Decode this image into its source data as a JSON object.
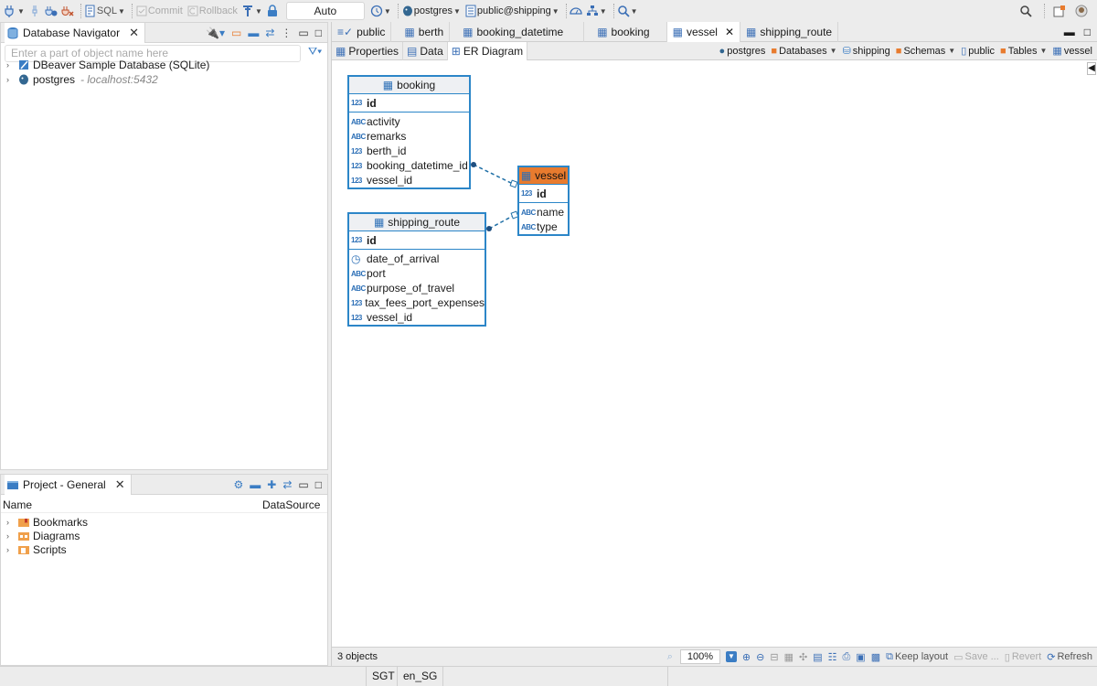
{
  "toolbar": {
    "sql_label": "SQL",
    "commit_label": "Commit",
    "rollback_label": "Rollback",
    "txn_mode": "Auto",
    "datasource": "postgres",
    "schema": "public@shipping"
  },
  "navigator": {
    "title": "Database Navigator",
    "filter_placeholder": "Enter a part of object name here",
    "items": [
      {
        "label": "DBeaver Sample Database (SQLite)",
        "host": ""
      },
      {
        "label": "postgres",
        "host": "- localhost:5432"
      }
    ]
  },
  "project": {
    "title": "Project - General",
    "col_name": "Name",
    "col_datasource": "DataSource",
    "items": [
      {
        "label": "Bookmarks"
      },
      {
        "label": "Diagrams"
      },
      {
        "label": "Scripts"
      }
    ]
  },
  "editor": {
    "tabs": [
      {
        "label": "public",
        "active": false
      },
      {
        "label": "berth",
        "active": false
      },
      {
        "label": "booking_datetime",
        "active": false
      },
      {
        "label": "booking",
        "active": false
      },
      {
        "label": "vessel",
        "active": true
      },
      {
        "label": "shipping_route",
        "active": false
      }
    ],
    "subtabs": [
      {
        "label": "Properties"
      },
      {
        "label": "Data"
      },
      {
        "label": "ER Diagram"
      }
    ],
    "crumbs": [
      {
        "label": "postgres"
      },
      {
        "label": "Databases"
      },
      {
        "label": "shipping"
      },
      {
        "label": "Schemas"
      },
      {
        "label": "public"
      },
      {
        "label": "Tables"
      },
      {
        "label": "vessel"
      }
    ]
  },
  "er": {
    "booking": {
      "title": "booking",
      "pk": "id",
      "pk_type": "123",
      "columns": [
        {
          "type": "ABC",
          "name": "activity"
        },
        {
          "type": "ABC",
          "name": "remarks"
        },
        {
          "type": "123",
          "name": "berth_id"
        },
        {
          "type": "123",
          "name": "booking_datetime_id"
        },
        {
          "type": "123",
          "name": "vessel_id"
        }
      ]
    },
    "shipping_route": {
      "title": "shipping_route",
      "pk": "id",
      "pk_type": "123",
      "columns": [
        {
          "type": "clock",
          "name": "date_of_arrival"
        },
        {
          "type": "ABC",
          "name": "port"
        },
        {
          "type": "ABC",
          "name": "purpose_of_travel"
        },
        {
          "type": "123",
          "name": "tax_fees_port_expenses"
        },
        {
          "type": "123",
          "name": "vessel_id"
        }
      ]
    },
    "vessel": {
      "title": "vessel",
      "pk": "id",
      "pk_type": "123",
      "columns": [
        {
          "type": "ABC",
          "name": "name"
        },
        {
          "type": "ABC",
          "name": "type"
        }
      ]
    }
  },
  "footer": {
    "objects": "3 objects",
    "zoom": "100%",
    "keep_layout": "Keep layout",
    "save": "Save ...",
    "revert": "Revert",
    "refresh": "Refresh"
  },
  "status": {
    "tz": "SGT",
    "locale": "en_SG"
  },
  "colors": {
    "accent": "#2c86c8",
    "highlight": "#e87b2e"
  }
}
